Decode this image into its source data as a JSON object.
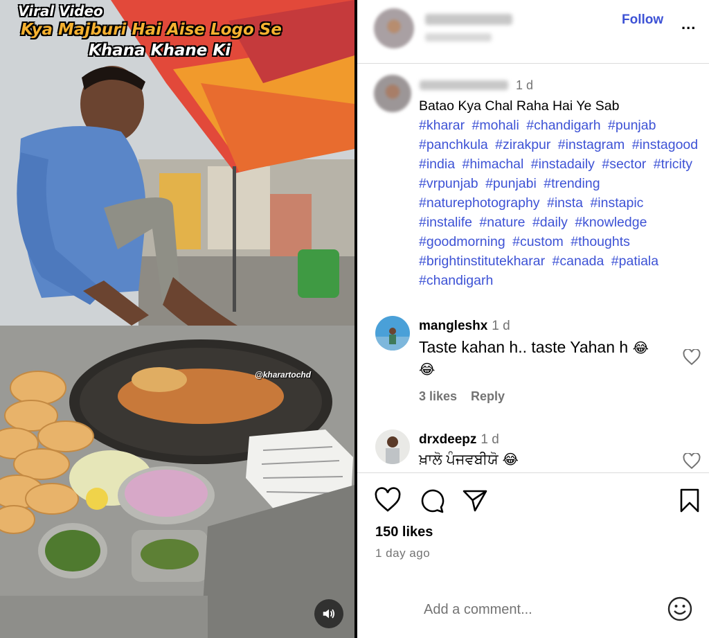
{
  "media": {
    "overlay_line1": "Viral Video",
    "overlay_line2": "Kya Majburi Hai Aise Logo Se",
    "overlay_line3": "Khana Khane Ki",
    "watermark": "@kharartochd",
    "mute_icon": "speaker-icon"
  },
  "header": {
    "follow_label": "Follow",
    "more_label": "..."
  },
  "caption": {
    "time": "1 d",
    "text": "Batao Kya Chal Raha Hai Ye Sab",
    "hashtags": [
      "#kharar",
      "#mohali",
      "#chandigarh",
      "#punjab",
      "#panchkula",
      "#zirakpur",
      "#instagram",
      "#instagood",
      "#india",
      "#himachal",
      "#instadaily",
      "#sector",
      "#tricity",
      "#vrpunjab",
      "#punjabi",
      "#trending",
      "#naturephotography",
      "#insta",
      "#instapic",
      "#instalife",
      "#nature",
      "#daily",
      "#knowledge",
      "#goodmorning",
      "#custom",
      "#thoughts",
      "#brightinstitutekharar",
      "#canada",
      "#patiala",
      "#chandigarh"
    ]
  },
  "comments": [
    {
      "username": "mangleshx",
      "time": "1 d",
      "text": "Taste kahan h.. taste Yahan h",
      "emoji": "😂",
      "emoji2": "😂",
      "likes": "3 likes",
      "reply": "Reply"
    },
    {
      "username": "drxdeepz",
      "time": "1 d",
      "text": "ਖ਼ਾਲੋ ਪੰਜਵਬੀਯੋ",
      "emoji": "😂"
    }
  ],
  "footer": {
    "likes": "150 likes",
    "date": "1 day ago",
    "comment_placeholder": "Add a comment..."
  },
  "icons": [
    "heart-icon",
    "comment-icon",
    "share-icon",
    "bookmark-icon",
    "smiley-icon"
  ],
  "colors": {
    "link": "#3d52d5",
    "muted": "#737373",
    "overlay_yellow": "#f5b130"
  }
}
